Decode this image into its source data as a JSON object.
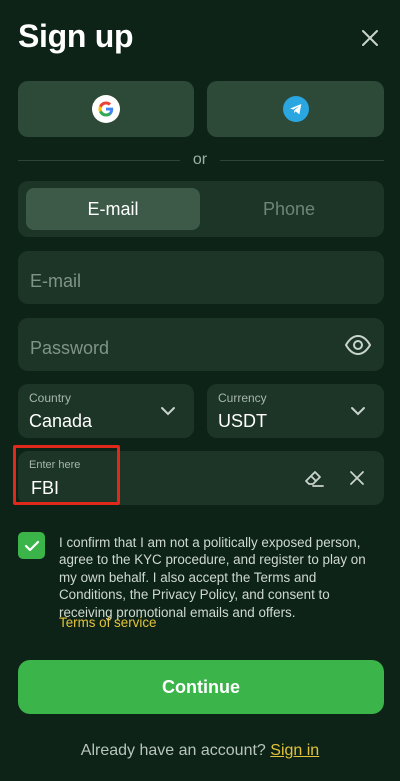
{
  "header": {
    "title": "Sign up"
  },
  "social": {
    "google_icon": "google-icon",
    "telegram_icon": "telegram-icon"
  },
  "divider": {
    "text": "or"
  },
  "tabs": [
    {
      "label": "E-mail",
      "active": true
    },
    {
      "label": "Phone",
      "active": false
    }
  ],
  "form": {
    "email_placeholder": "E-mail",
    "password_placeholder": "Password",
    "country": {
      "label": "Country",
      "value": "Canada"
    },
    "currency": {
      "label": "Currency",
      "value": "USDT"
    },
    "promo": {
      "label": "Enter here",
      "value": "FBI"
    }
  },
  "consent": {
    "checked": true,
    "text": "I confirm that I am not a politically exposed person, agree to the KYC procedure, and register to play on my own behalf. I also accept the Terms and Conditions, the Privacy Policy, and consent to receiving promotional emails and offers.",
    "terms_link": "Terms of service"
  },
  "continue_label": "Continue",
  "footer": {
    "prompt": "Already have an account?",
    "link": "Sign in"
  },
  "colors": {
    "background": "#0d2317",
    "accent": "#3bb54a",
    "link": "#e3c33b",
    "highlight": "#e0291b"
  }
}
